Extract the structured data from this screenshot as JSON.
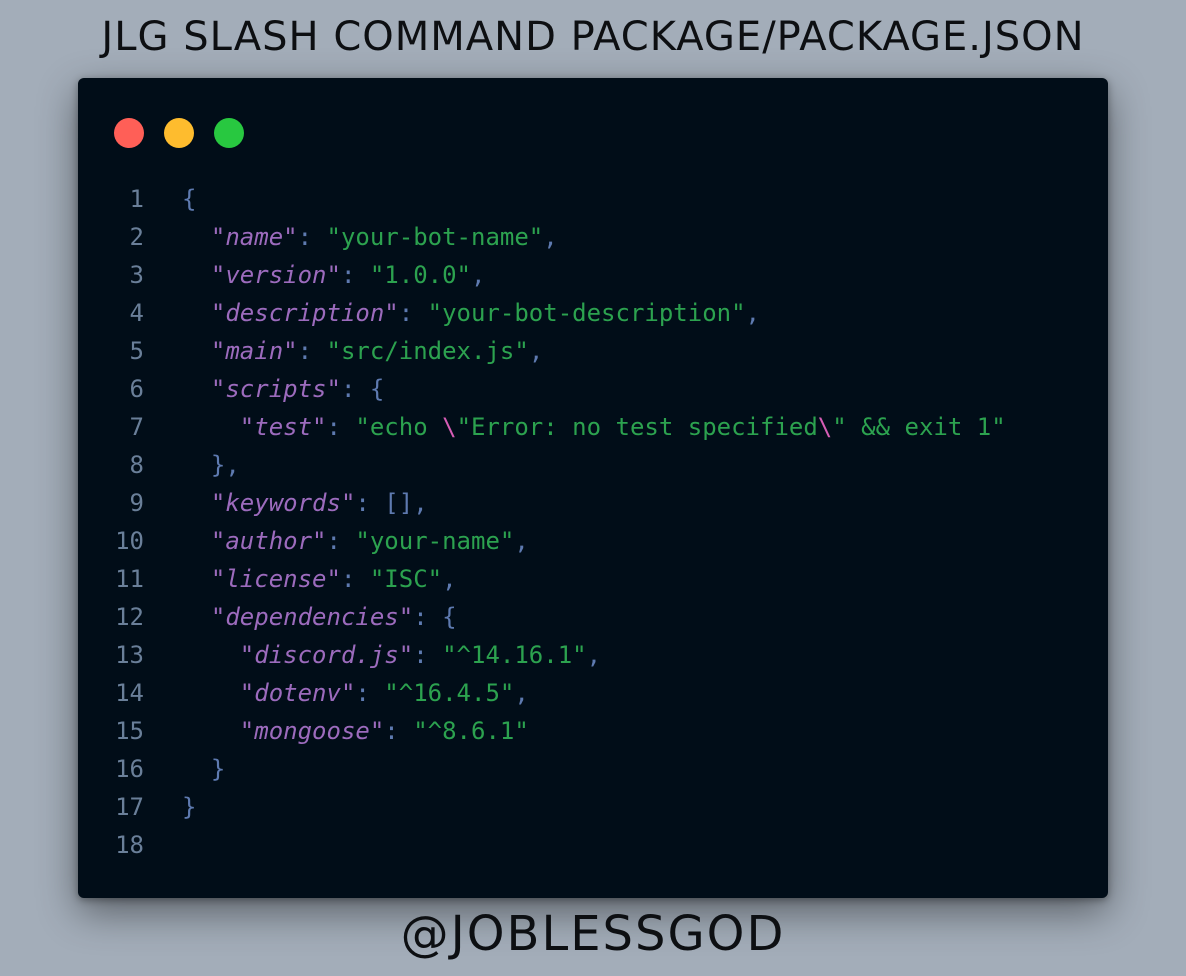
{
  "page": {
    "title": "JLG SLASH COMMAND PACKAGE/PACKAGE.JSON",
    "footer": "@JOBLESSGOD"
  },
  "window": {
    "controls": [
      {
        "name": "close-dot",
        "color": "#ff5f57"
      },
      {
        "name": "minimize-dot",
        "color": "#febc2e"
      },
      {
        "name": "maximize-dot",
        "color": "#28c840"
      }
    ]
  },
  "colors": {
    "background": "#a3adb9",
    "editor": "#010d18",
    "line_number": "#6a7f99",
    "key": "#9c6bbd",
    "string": "#2ca24f",
    "punctuation": "#5e7ab0",
    "escape": "#d65db5"
  },
  "code": {
    "language": "json",
    "lines": [
      {
        "n": "1",
        "tokens": [
          {
            "t": "{",
            "c": "punc"
          }
        ]
      },
      {
        "n": "2",
        "tokens": [
          {
            "t": "  ",
            "c": "punc"
          },
          {
            "t": "\"name\"",
            "c": "key"
          },
          {
            "t": ": ",
            "c": "punc"
          },
          {
            "t": "\"your-bot-name\"",
            "c": "str"
          },
          {
            "t": ",",
            "c": "punc"
          }
        ]
      },
      {
        "n": "3",
        "tokens": [
          {
            "t": "  ",
            "c": "punc"
          },
          {
            "t": "\"version\"",
            "c": "key"
          },
          {
            "t": ": ",
            "c": "punc"
          },
          {
            "t": "\"1.0.0\"",
            "c": "str"
          },
          {
            "t": ",",
            "c": "punc"
          }
        ]
      },
      {
        "n": "4",
        "tokens": [
          {
            "t": "  ",
            "c": "punc"
          },
          {
            "t": "\"description\"",
            "c": "key"
          },
          {
            "t": ": ",
            "c": "punc"
          },
          {
            "t": "\"your-bot-description\"",
            "c": "str"
          },
          {
            "t": ",",
            "c": "punc"
          }
        ]
      },
      {
        "n": "5",
        "tokens": [
          {
            "t": "  ",
            "c": "punc"
          },
          {
            "t": "\"main\"",
            "c": "key"
          },
          {
            "t": ": ",
            "c": "punc"
          },
          {
            "t": "\"src/index.js\"",
            "c": "str"
          },
          {
            "t": ",",
            "c": "punc"
          }
        ]
      },
      {
        "n": "6",
        "tokens": [
          {
            "t": "  ",
            "c": "punc"
          },
          {
            "t": "\"scripts\"",
            "c": "key"
          },
          {
            "t": ": {",
            "c": "punc"
          }
        ]
      },
      {
        "n": "7",
        "tokens": [
          {
            "t": "    ",
            "c": "punc"
          },
          {
            "t": "\"test\"",
            "c": "key"
          },
          {
            "t": ": ",
            "c": "punc"
          },
          {
            "t": "\"echo ",
            "c": "str"
          },
          {
            "t": "\\",
            "c": "esc"
          },
          {
            "t": "\"Error: no test specified",
            "c": "str"
          },
          {
            "t": "\\",
            "c": "esc"
          },
          {
            "t": "\" && exit 1\"",
            "c": "str"
          }
        ]
      },
      {
        "n": "8",
        "tokens": [
          {
            "t": "  },",
            "c": "punc"
          }
        ]
      },
      {
        "n": "9",
        "tokens": [
          {
            "t": "  ",
            "c": "punc"
          },
          {
            "t": "\"keywords\"",
            "c": "key"
          },
          {
            "t": ": [],",
            "c": "punc"
          }
        ]
      },
      {
        "n": "10",
        "tokens": [
          {
            "t": "  ",
            "c": "punc"
          },
          {
            "t": "\"author\"",
            "c": "key"
          },
          {
            "t": ": ",
            "c": "punc"
          },
          {
            "t": "\"your-name\"",
            "c": "str"
          },
          {
            "t": ",",
            "c": "punc"
          }
        ]
      },
      {
        "n": "11",
        "tokens": [
          {
            "t": "  ",
            "c": "punc"
          },
          {
            "t": "\"license\"",
            "c": "key"
          },
          {
            "t": ": ",
            "c": "punc"
          },
          {
            "t": "\"ISC\"",
            "c": "str"
          },
          {
            "t": ",",
            "c": "punc"
          }
        ]
      },
      {
        "n": "12",
        "tokens": [
          {
            "t": "  ",
            "c": "punc"
          },
          {
            "t": "\"dependencies\"",
            "c": "key"
          },
          {
            "t": ": {",
            "c": "punc"
          }
        ]
      },
      {
        "n": "13",
        "tokens": [
          {
            "t": "    ",
            "c": "punc"
          },
          {
            "t": "\"discord.js\"",
            "c": "key"
          },
          {
            "t": ": ",
            "c": "punc"
          },
          {
            "t": "\"^14.16.1\"",
            "c": "str"
          },
          {
            "t": ",",
            "c": "punc"
          }
        ]
      },
      {
        "n": "14",
        "tokens": [
          {
            "t": "    ",
            "c": "punc"
          },
          {
            "t": "\"dotenv\"",
            "c": "key"
          },
          {
            "t": ": ",
            "c": "punc"
          },
          {
            "t": "\"^16.4.5\"",
            "c": "str"
          },
          {
            "t": ",",
            "c": "punc"
          }
        ]
      },
      {
        "n": "15",
        "tokens": [
          {
            "t": "    ",
            "c": "punc"
          },
          {
            "t": "\"mongoose\"",
            "c": "key"
          },
          {
            "t": ": ",
            "c": "punc"
          },
          {
            "t": "\"^8.6.1\"",
            "c": "str"
          }
        ]
      },
      {
        "n": "16",
        "tokens": [
          {
            "t": "  }",
            "c": "punc"
          }
        ]
      },
      {
        "n": "17",
        "tokens": [
          {
            "t": "}",
            "c": "punc"
          }
        ]
      },
      {
        "n": "18",
        "tokens": []
      }
    ]
  }
}
